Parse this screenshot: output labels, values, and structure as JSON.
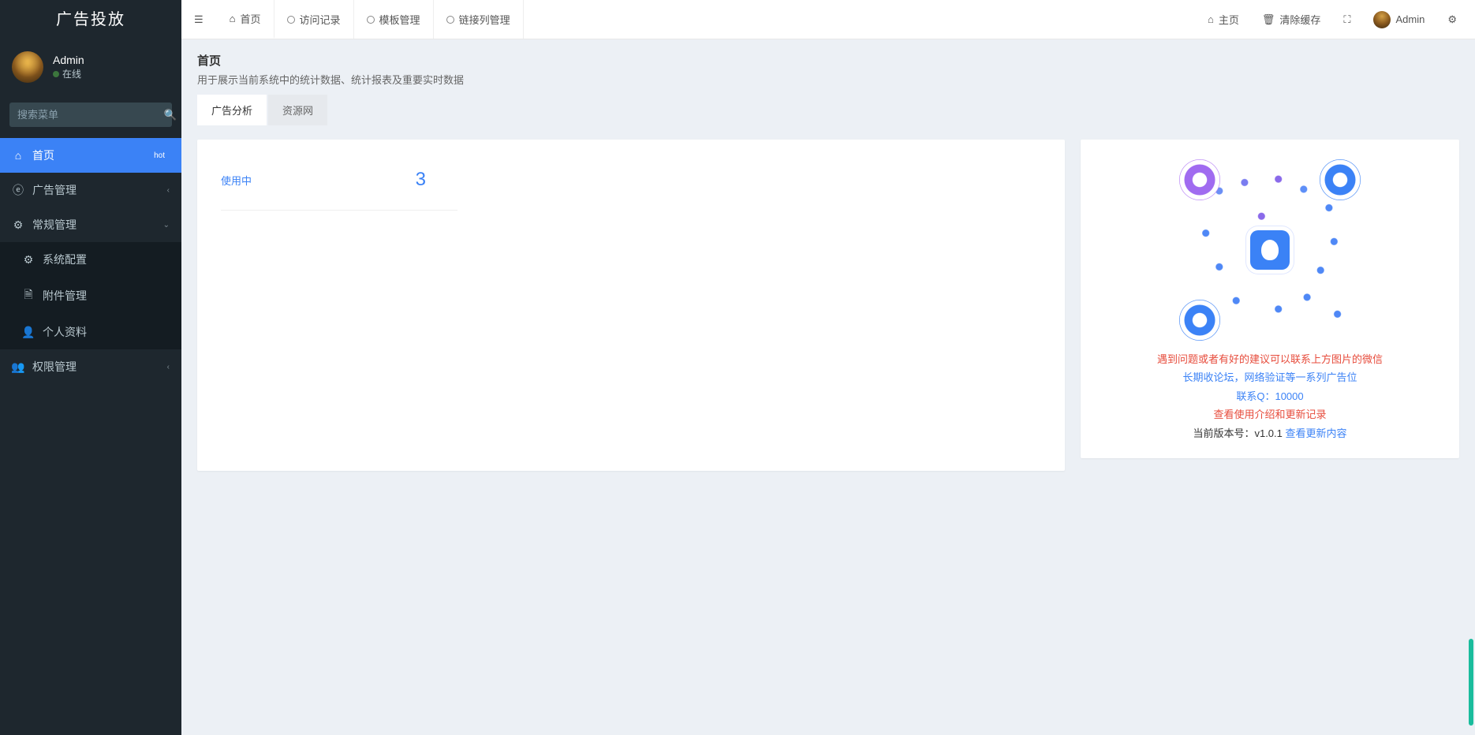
{
  "brand": "广告投放",
  "user": {
    "name": "Admin",
    "status": "在线"
  },
  "search": {
    "placeholder": "搜索菜单"
  },
  "sidebar": {
    "items": [
      {
        "label": "首页",
        "badge": "hot"
      },
      {
        "label": "广告管理"
      },
      {
        "label": "常规管理"
      },
      {
        "label": "系统配置"
      },
      {
        "label": "附件管理"
      },
      {
        "label": "个人资料"
      },
      {
        "label": "权限管理"
      }
    ]
  },
  "topbar": {
    "tabs": [
      {
        "label": "首页"
      },
      {
        "label": "访问记录"
      },
      {
        "label": "模板管理"
      },
      {
        "label": "链接列管理"
      }
    ],
    "right": {
      "home": "主页",
      "clear": "清除缓存",
      "user": "Admin"
    }
  },
  "page": {
    "title": "首页",
    "subtitle": "用于展示当前系统中的统计数据、统计报表及重要实时数据",
    "content_tabs": {
      "t0": "广告分析",
      "t1": "资源网"
    },
    "stat": {
      "label": "使用中",
      "value": "3"
    }
  },
  "notice": {
    "l1": "遇到问题或者有好的建议可以联系上方图片的微信",
    "l2": "长期收论坛，网络验证等一系列广告位",
    "l3": "联系Q：10000",
    "l4": "查看使用介绍和更新记录",
    "version_label": "当前版本号：",
    "version": "v1.0.1",
    "update_link": "查看更新内容"
  }
}
